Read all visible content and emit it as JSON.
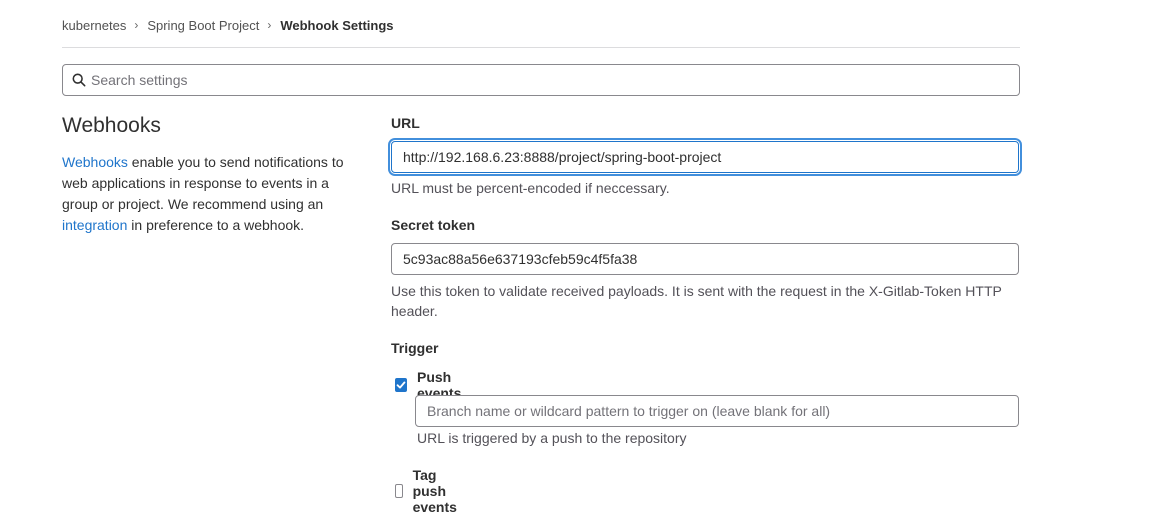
{
  "breadcrumb": {
    "items": [
      "kubernetes",
      "Spring Boot Project"
    ],
    "current": "Webhook Settings",
    "separator": "›"
  },
  "search": {
    "placeholder": "Search settings",
    "value": ""
  },
  "section": {
    "title": "Webhooks",
    "desc_link1": "Webhooks",
    "desc_part1": " enable you to send notifications to web applications in response to events in a group or project. We recommend using an ",
    "desc_link2": "integration",
    "desc_part2": " in preference to a webhook."
  },
  "form": {
    "url_label": "URL",
    "url_value": "http://192.168.6.23:8888/project/spring-boot-project",
    "url_help": "URL must be percent-encoded if neccessary.",
    "token_label": "Secret token",
    "token_value": "5c93ac88a56e637193cfeb59c4f5fa38",
    "token_help": "Use this token to validate received payloads. It is sent with the request in the X-Gitlab-Token HTTP header.",
    "trigger_label": "Trigger",
    "push_events_label": "Push events",
    "push_events_checked": true,
    "branch_placeholder": "Branch name or wildcard pattern to trigger on (leave blank for all)",
    "push_help": "URL is triggered by a push to the repository",
    "tag_push_label": "Tag push events",
    "tag_push_checked": false
  },
  "colors": {
    "accent": "#1f75cb",
    "focus_ring": "#428fdc",
    "border": "#89888d"
  }
}
